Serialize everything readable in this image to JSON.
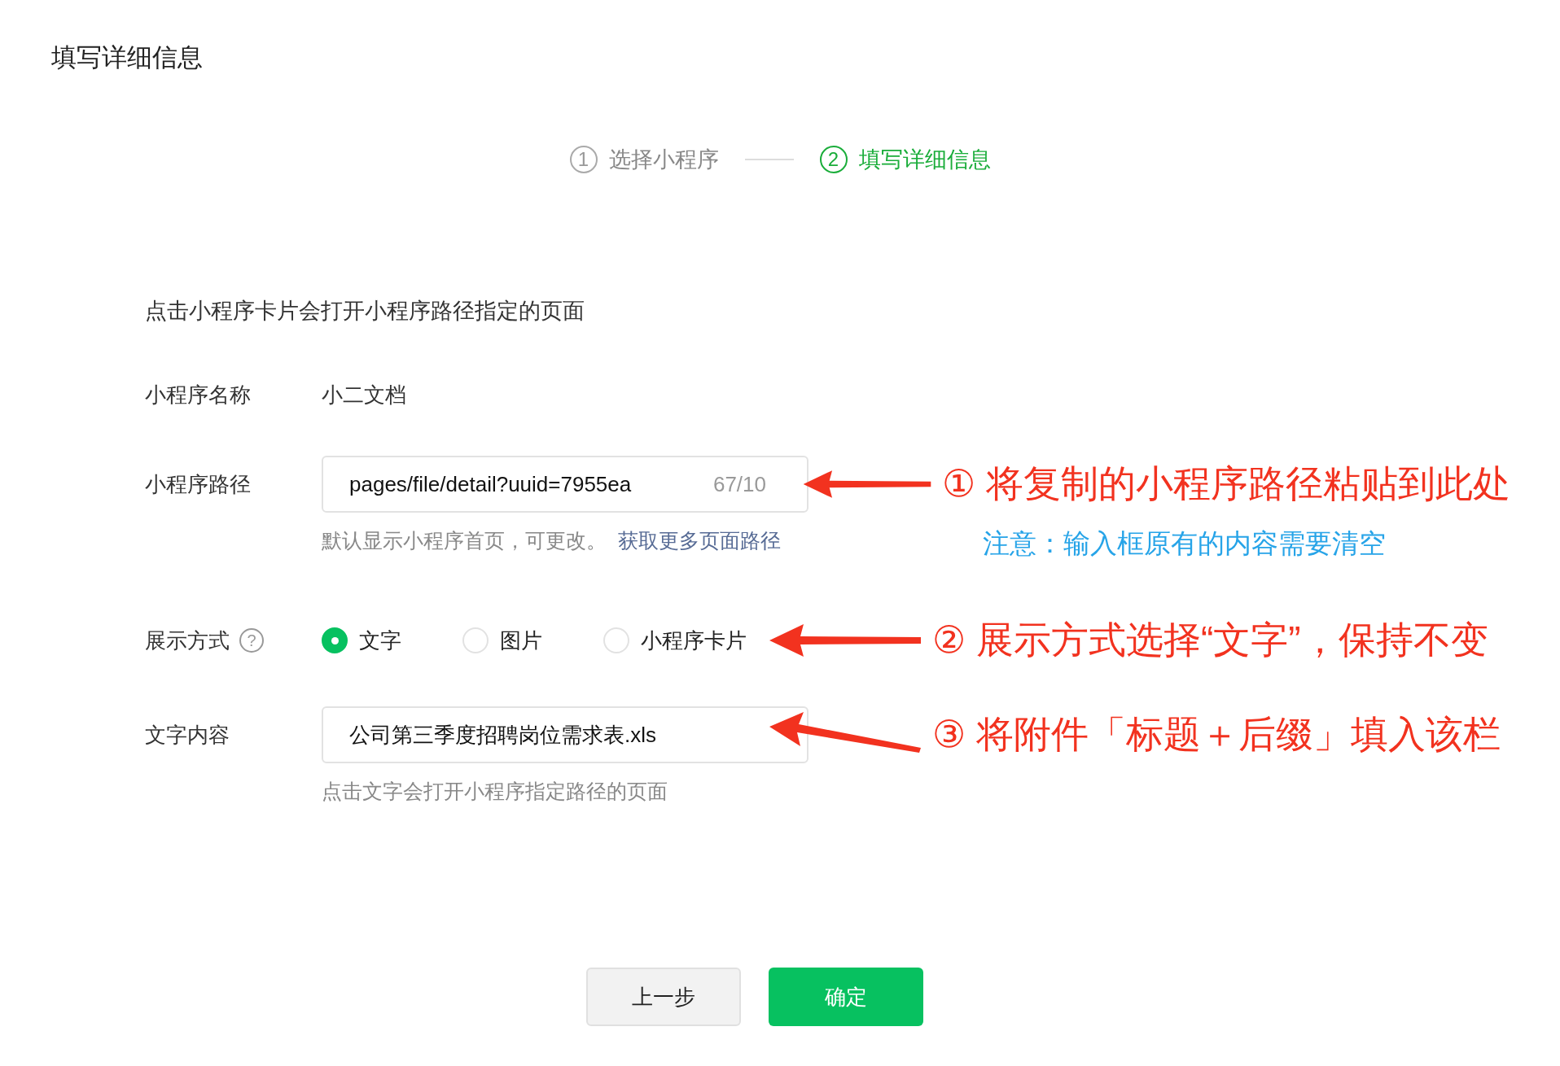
{
  "title": "填写详细信息",
  "steps": [
    {
      "number": "1",
      "label": "选择小程序",
      "selected": false
    },
    {
      "number": "2",
      "label": "填写详细信息",
      "selected": true
    }
  ],
  "intro": "点击小程序卡片会打开小程序路径指定的页面",
  "rows": [
    {
      "kind": "static",
      "label": "小程序名称",
      "value": "小二文档"
    },
    {
      "kind": "input",
      "label": "小程序路径",
      "value": "pages/file/detail?uuid=7955ea",
      "counter": "67/10",
      "help": "默认显示小程序首页，可更改。",
      "link": "获取更多页面路径",
      "annotation": {
        "text": "① 将复制的小程序路径粘贴到此处",
        "note": "注意：输入框原有的内容需要清空"
      }
    },
    {
      "kind": "radio",
      "label": "展示方式",
      "hint_mark": "?",
      "options": [
        {
          "label": "文字",
          "selected": true
        },
        {
          "label": "图片",
          "selected": false
        },
        {
          "label": "小程序卡片",
          "selected": false
        }
      ],
      "annotation": {
        "text": "② 展示方式选择“文字”，保持不变"
      }
    },
    {
      "kind": "input",
      "label": "文字内容",
      "value": "公司第三季度招聘岗位需求表.xls",
      "help": "点击文字会打开小程序指定路径的页面",
      "annotation": {
        "text": "③ 将附件「标题＋后缀」填入该栏"
      }
    }
  ],
  "buttons": [
    {
      "label": "上一步",
      "kind": "secondary"
    },
    {
      "label": "确定",
      "kind": "primary"
    }
  ]
}
